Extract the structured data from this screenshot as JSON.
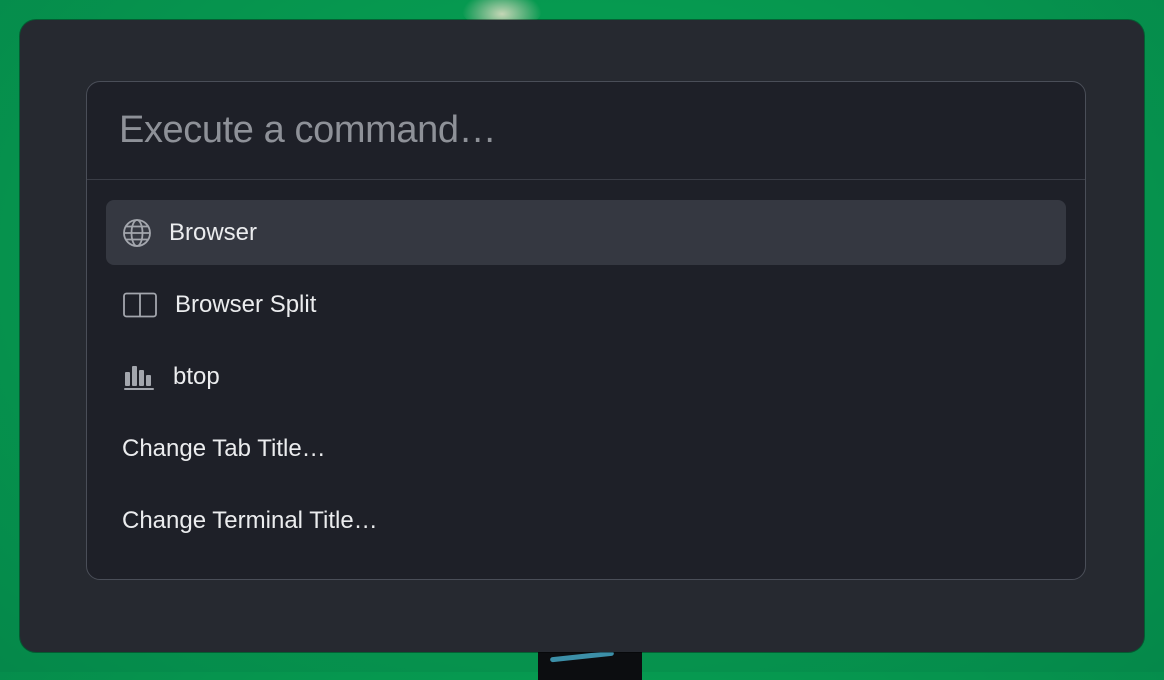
{
  "command_palette": {
    "search": {
      "placeholder": "Execute a command…",
      "value": ""
    },
    "items": [
      {
        "label": "Browser",
        "icon": "globe-icon",
        "selected": true
      },
      {
        "label": "Browser Split",
        "icon": "split-view-icon",
        "selected": false
      },
      {
        "label": "btop",
        "icon": "bar-chart-icon",
        "selected": false
      },
      {
        "label": "Change Tab Title…",
        "icon": null,
        "selected": false
      },
      {
        "label": "Change Terminal Title…",
        "icon": null,
        "selected": false
      }
    ]
  },
  "colors": {
    "desktop_background": "#069a50",
    "window_background": "#262930",
    "palette_background": "#1e2028",
    "selected_item_background": "#353841",
    "text": "#ebecee",
    "placeholder_text": "#8e9198"
  }
}
